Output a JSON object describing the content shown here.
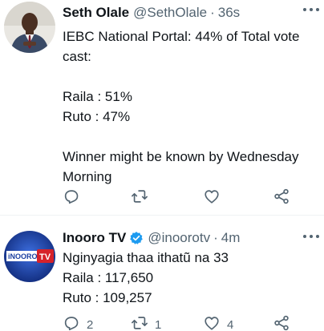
{
  "tweets": [
    {
      "name": "Seth Olale",
      "handle": "@SethOlale",
      "separator": "·",
      "time": "36s",
      "lines": [
        "IEBC National Portal: 44% of Total vote",
        "cast:",
        "",
        "Raila : 51%",
        "Ruto : 47%",
        "",
        "Winner might be known by Wednesday",
        "Morning"
      ],
      "reply_count": "",
      "retweet_count": "",
      "like_count": ""
    },
    {
      "name": "Inooro TV",
      "handle": "@inoorotv",
      "separator": "·",
      "time": "4m",
      "avatar_logo_text": "iNOORO TV",
      "lines": [
        "Nginyagia thaa ithatũ na 33",
        "Raila : 117,650",
        "Ruto : 109,257"
      ],
      "reply_count": "2",
      "retweet_count": "1",
      "like_count": "4"
    }
  ],
  "colors": {
    "text": "#0f1419",
    "secondary": "#536471",
    "verified": "#1d9bf0",
    "inooro_red": "#d6222a",
    "inooro_blue": "#1a3fa0"
  },
  "icons": [
    "reply-icon",
    "retweet-icon",
    "like-icon",
    "share-icon",
    "verified-badge-icon",
    "more-icon"
  ]
}
